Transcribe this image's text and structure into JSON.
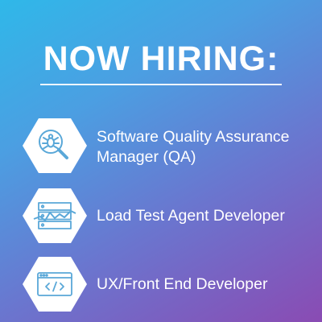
{
  "headline": "NOW HIRING:",
  "colors": {
    "gradient_start": "#2fb8e9",
    "gradient_end": "#8a4bb3",
    "hexagon_fill": "#ffffff",
    "icon_stroke": "#5aa8d8"
  },
  "jobs": [
    {
      "title": "Software Quality Assurance Manager (QA)",
      "icon": "bug-magnifier-icon"
    },
    {
      "title": "Load Test Agent Developer",
      "icon": "server-load-graph-icon"
    },
    {
      "title": "UX/Front End Developer",
      "icon": "code-window-icon"
    }
  ]
}
